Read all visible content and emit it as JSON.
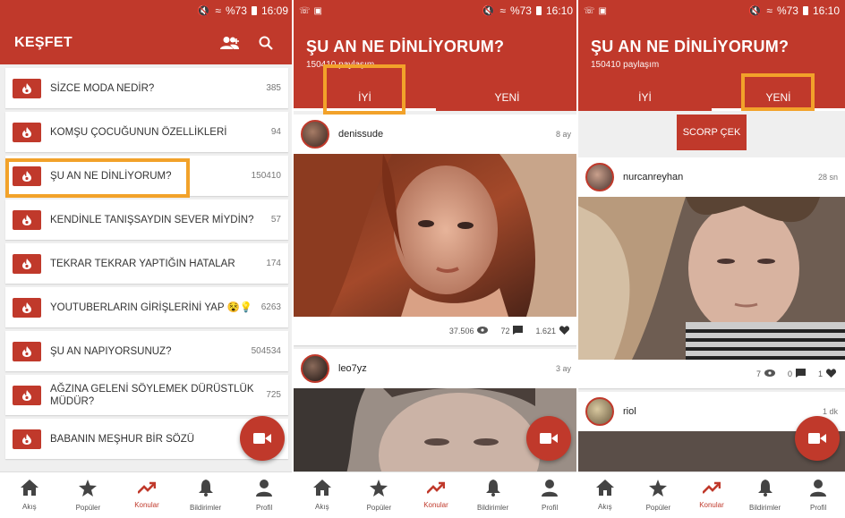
{
  "colors": {
    "brand": "#c0392b",
    "highlight": "#f2a22a"
  },
  "status": {
    "p1": {
      "icons_left": [],
      "signal_text": "%73",
      "time": "16:09"
    },
    "p2": {
      "icons_left": [
        "whatsapp-icon",
        "image-icon"
      ],
      "signal_text": "%73",
      "time": "16:10"
    },
    "p3": {
      "icons_left": [
        "whatsapp-icon",
        "image-icon"
      ],
      "signal_text": "%73",
      "time": "16:10"
    }
  },
  "panel1": {
    "title": "KEŞFET",
    "icons": [
      "add-people-icon",
      "search-icon"
    ],
    "topics": [
      {
        "title": "SİZCE MODA NEDİR?",
        "count": "385"
      },
      {
        "title": "KOMŞU ÇOCUĞUNUN ÖZELLİKLERİ",
        "count": "94"
      },
      {
        "title": "ŞU AN NE DİNLİYORUM?",
        "count": "150410"
      },
      {
        "title": "KENDİNLE TANIŞSAYDIN SEVER MİYDİN?",
        "count": "57"
      },
      {
        "title": "TEKRAR TEKRAR YAPTIĞIN HATALAR",
        "count": "174"
      },
      {
        "title": "YOUTUBERLARIN GİRİŞLERİNİ YAP 😵💡",
        "count": "6263"
      },
      {
        "title": "ŞU AN NAPIYORSUNUZ?",
        "count": "504534"
      },
      {
        "title": "AĞZINA GELENİ SÖYLEMEK DÜRÜSTLÜK MÜDÜR?",
        "count": "725"
      },
      {
        "title": "BABANIN MEŞHUR BİR SÖZÜ",
        "count": ""
      }
    ]
  },
  "panel2": {
    "title": "ŞU AN NE DİNLİYORUM?",
    "subtitle": "150410 paylaşım",
    "tabs": [
      "İYİ",
      "YENİ"
    ],
    "active_tab": 0,
    "posts": [
      {
        "user": "denissude",
        "time": "8 ay",
        "views": "37.506",
        "comments": "72",
        "likes": "1.621"
      },
      {
        "user": "leo7yz",
        "time": "3 ay"
      }
    ]
  },
  "panel3": {
    "title": "ŞU AN NE DİNLİYORUM?",
    "subtitle": "150410 paylaşım",
    "tabs": [
      "İYİ",
      "YENİ"
    ],
    "active_tab": 1,
    "scorp_button": "SCORP ÇEK",
    "posts": [
      {
        "user": "nurcanreyhan",
        "time": "28 sn",
        "views": "7",
        "comments": "0",
        "likes": "1"
      },
      {
        "user": "riol",
        "time": "1 dk"
      }
    ]
  },
  "nav": [
    {
      "label": "Akış",
      "icon": "home-icon"
    },
    {
      "label": "Popüler",
      "icon": "star-icon"
    },
    {
      "label": "Konular",
      "icon": "trending-icon"
    },
    {
      "label": "Bildirimler",
      "icon": "bell-icon"
    },
    {
      "label": "Profil",
      "icon": "person-icon"
    }
  ],
  "nav_active": 2
}
